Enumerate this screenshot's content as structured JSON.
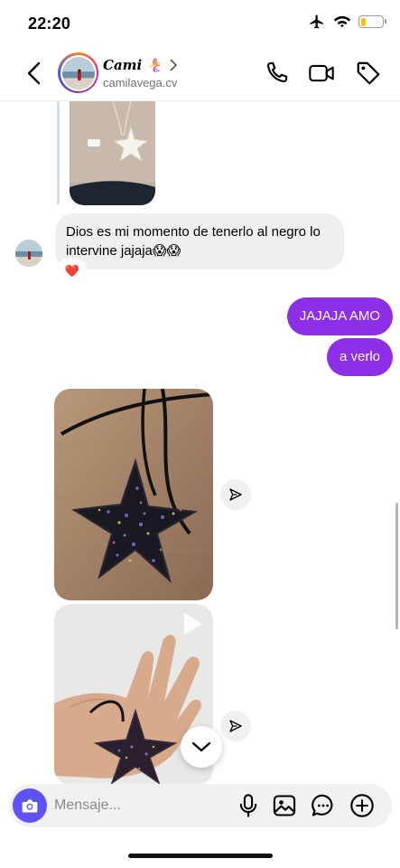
{
  "status_bar": {
    "time": "22:20",
    "icons": [
      "airplane-icon",
      "wifi-icon",
      "battery-icon"
    ],
    "battery_level": 0.2,
    "battery_color": "#f3c311"
  },
  "header": {
    "name": "Cami",
    "username": "camilavega.cv",
    "icons": [
      "back-arrow-icon",
      "chevron-right-icon",
      "phone-icon",
      "video-camera-icon",
      "tag-icon"
    ]
  },
  "messages": {
    "incoming_text": "Dios es mi momento de tenerlo al negro lo intervine jajaja😱😱",
    "reaction": "❤️",
    "outgoing": [
      "JAJAJA AMO",
      "a verlo"
    ]
  },
  "colors": {
    "outgoing_bubble": "#8e2fe8",
    "incoming_bubble": "#efefef",
    "camera_button": "#5f52f5"
  },
  "composer": {
    "placeholder": "Mensaje...",
    "icons": [
      "camera-icon",
      "microphone-icon",
      "gallery-icon",
      "sticker-icon",
      "plus-icon"
    ]
  }
}
